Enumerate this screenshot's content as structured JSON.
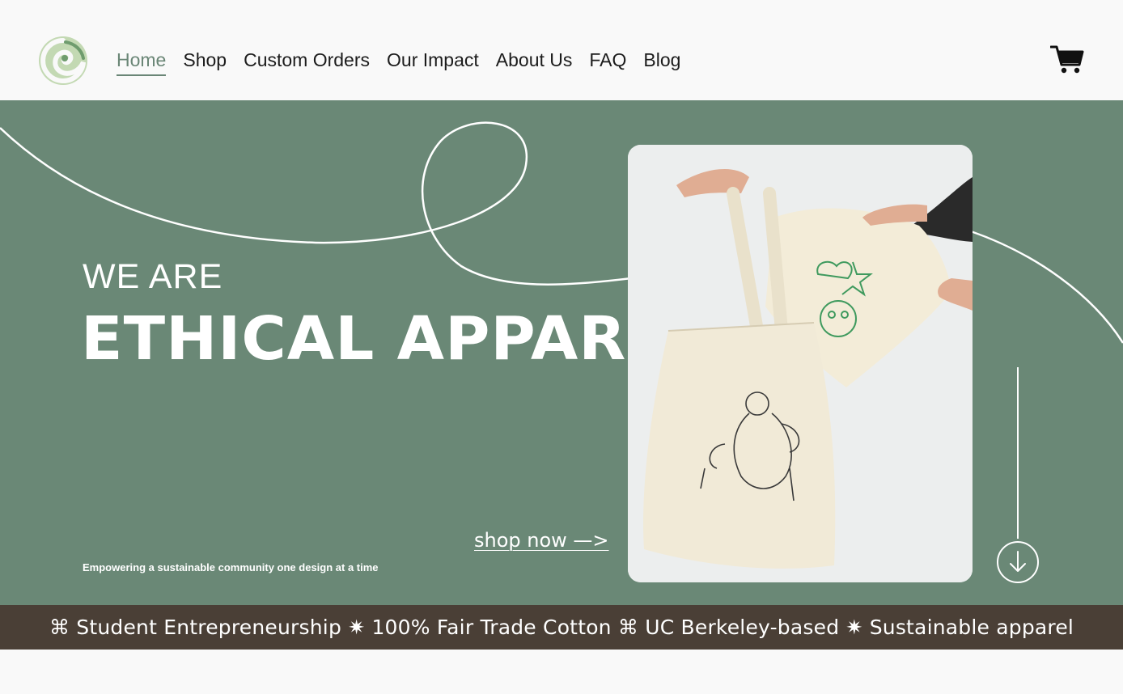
{
  "header": {
    "logo_icon": "swirl-logo-icon",
    "nav": [
      {
        "label": "Home",
        "active": true
      },
      {
        "label": "Shop",
        "active": false
      },
      {
        "label": "Custom Orders",
        "active": false
      },
      {
        "label": "Our Impact",
        "active": false
      },
      {
        "label": "About Us",
        "active": false
      },
      {
        "label": "FAQ",
        "active": false
      },
      {
        "label": "Blog",
        "active": false
      }
    ],
    "cart_icon": "cart-icon"
  },
  "hero": {
    "kicker": "WE ARE",
    "headline": "ETHICAL APPAREL",
    "tagline": "Empowering a sustainable community one design at a time",
    "shop_now": "shop now —>",
    "photo_icon": "tote-bag-photo",
    "scroll_icon": "arrow-down-circle-icon"
  },
  "ticker": {
    "text": "⌘ Student Entrepreneurship ✷ 100% Fair Trade Cotton ⌘ UC Berkeley-based ✷ Sustainable apparel"
  },
  "colors": {
    "hero_green": "#6a8876",
    "nav_active": "#6a8676",
    "ticker_brown": "#4a3f36",
    "logo_green": "#c1d8b0"
  }
}
